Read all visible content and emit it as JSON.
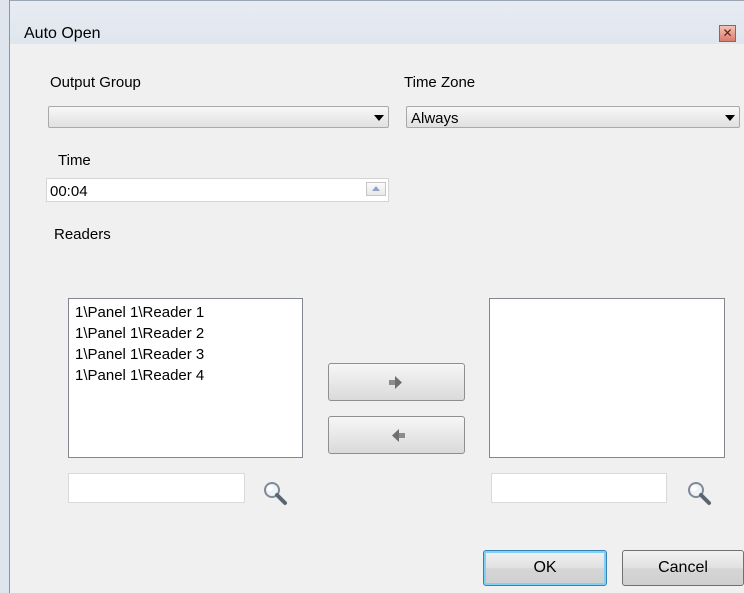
{
  "window": {
    "title": "Auto Open"
  },
  "output_group": {
    "label": "Output  Group",
    "value": ""
  },
  "time_zone": {
    "label": "Time Zone",
    "value": "Always"
  },
  "time": {
    "label": "Time",
    "value": "00:04"
  },
  "readers": {
    "label": "Readers",
    "available": [
      "1\\Panel 1\\Reader 1",
      "1\\Panel 1\\Reader 2",
      "1\\Panel 1\\Reader 3",
      "1\\Panel 1\\Reader 4"
    ],
    "selected": []
  },
  "buttons": {
    "ok": "OK",
    "cancel": "Cancel"
  }
}
